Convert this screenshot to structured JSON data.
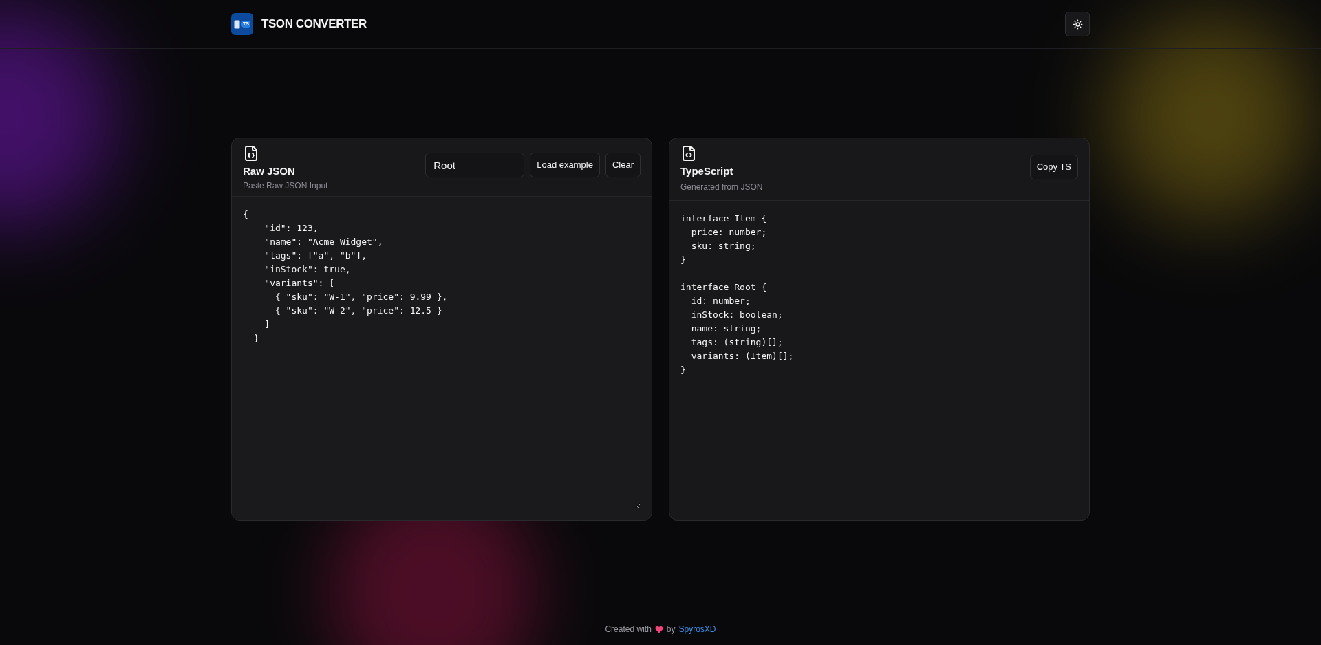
{
  "header": {
    "logo_badge": "TS",
    "title": "TSON CONVERTER"
  },
  "input_panel": {
    "title": "Raw JSON",
    "subtitle": "Paste Raw JSON Input",
    "root_name": {
      "value": "Root"
    },
    "buttons": [
      "Load example",
      "Clear"
    ],
    "code": "{\n    \"id\": 123,\n    \"name\": \"Acme Widget\",\n    \"tags\": [\"a\", \"b\"],\n    \"inStock\": true,\n    \"variants\": [\n      { \"sku\": \"W-1\", \"price\": 9.99 },\n      { \"sku\": \"W-2\", \"price\": 12.5 }\n    ]\n  }"
  },
  "output_panel": {
    "title": "TypeScript",
    "subtitle": "Generated from JSON",
    "buttons": [
      "Copy TS"
    ],
    "code": "interface Item {\n  price: number;\n  sku: string;\n}\n\ninterface Root {\n  id: number;\n  inStock: boolean;\n  name: string;\n  tags: (string)[];\n  variants: (Item)[];\n}"
  },
  "footer": {
    "prefix": "Created with",
    "middle": "by",
    "author": "SpyrosXD"
  }
}
